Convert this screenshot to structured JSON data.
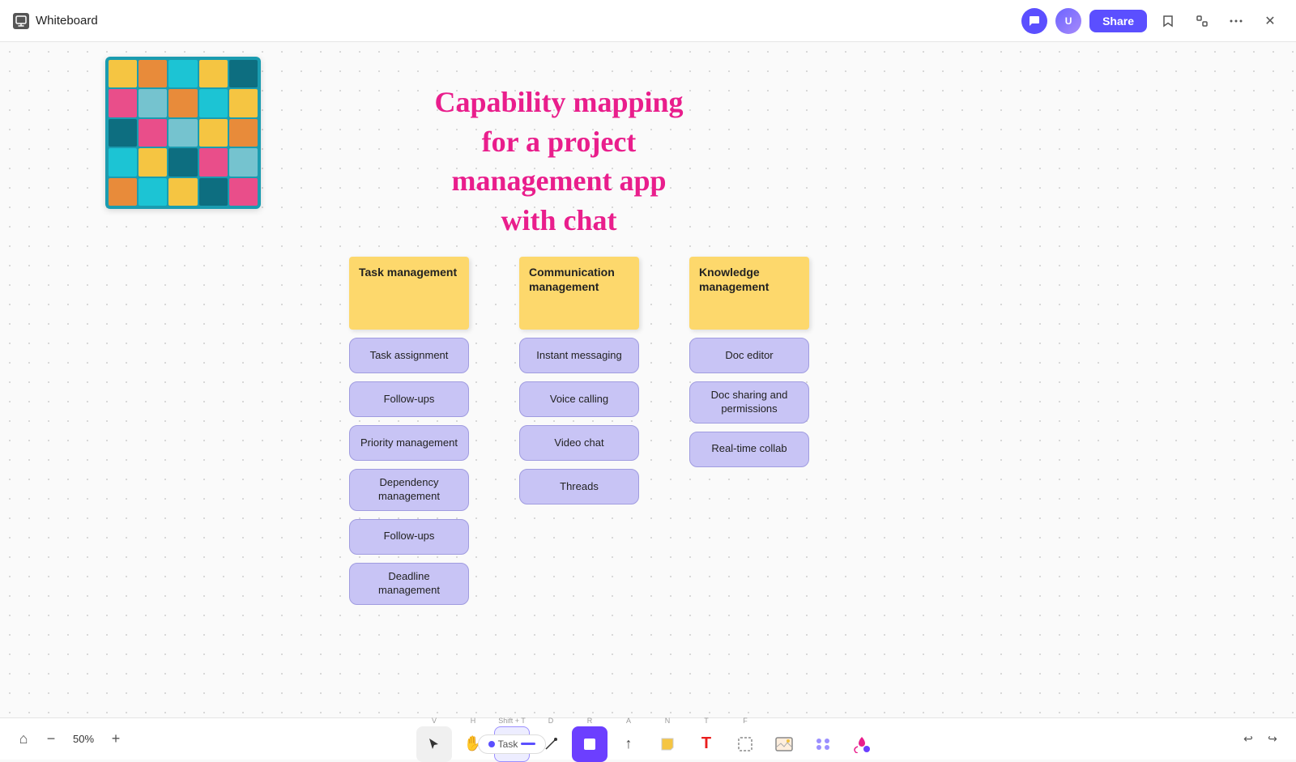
{
  "topbar": {
    "title": "Whiteboard",
    "share_label": "Share"
  },
  "canvas": {
    "main_title_line1": "Capability mapping",
    "main_title_line2": "for a project",
    "main_title_line3": "management app",
    "main_title_line4": "with chat"
  },
  "columns": [
    {
      "id": "task",
      "header": "Task management",
      "items": [
        "Task assignment",
        "Follow-ups",
        "Priority management",
        "Dependency management",
        "Follow-ups",
        "Deadline management"
      ]
    },
    {
      "id": "communication",
      "header": "Communication management",
      "items": [
        "Instant messaging",
        "Voice calling",
        "Video chat",
        "Threads"
      ]
    },
    {
      "id": "knowledge",
      "header": "Knowledge management",
      "items": [
        "Doc editor",
        "Doc sharing and permissions",
        "Real-time collab"
      ]
    }
  ],
  "toolbar": {
    "zoom_level": "50%",
    "tools": [
      {
        "id": "select",
        "label": "V",
        "icon": "↖",
        "name": "select-tool"
      },
      {
        "id": "hand",
        "label": "H",
        "icon": "✋",
        "name": "hand-tool"
      },
      {
        "id": "task",
        "label": "Shift+T",
        "name": "task-tool",
        "pill": "Task"
      },
      {
        "id": "pen",
        "label": "D",
        "icon": "✏",
        "name": "pen-tool"
      },
      {
        "id": "shape",
        "label": "R",
        "icon": "■",
        "name": "shape-tool",
        "color": "purple"
      },
      {
        "id": "arrow",
        "label": "A",
        "icon": "↑",
        "name": "arrow-tool"
      },
      {
        "id": "note",
        "label": "N",
        "icon": "◆",
        "name": "note-tool"
      },
      {
        "id": "text",
        "label": "T",
        "icon": "T",
        "name": "text-tool",
        "color": "red"
      },
      {
        "id": "frame",
        "label": "F",
        "icon": "⬜",
        "name": "frame-tool"
      },
      {
        "id": "image",
        "label": "none",
        "icon": "🖼",
        "name": "image-tool"
      },
      {
        "id": "components",
        "label": "none",
        "icon": "⚙",
        "name": "components-tool"
      },
      {
        "id": "plugin",
        "label": "none",
        "icon": "🎨",
        "name": "plugin-tool"
      }
    ]
  }
}
